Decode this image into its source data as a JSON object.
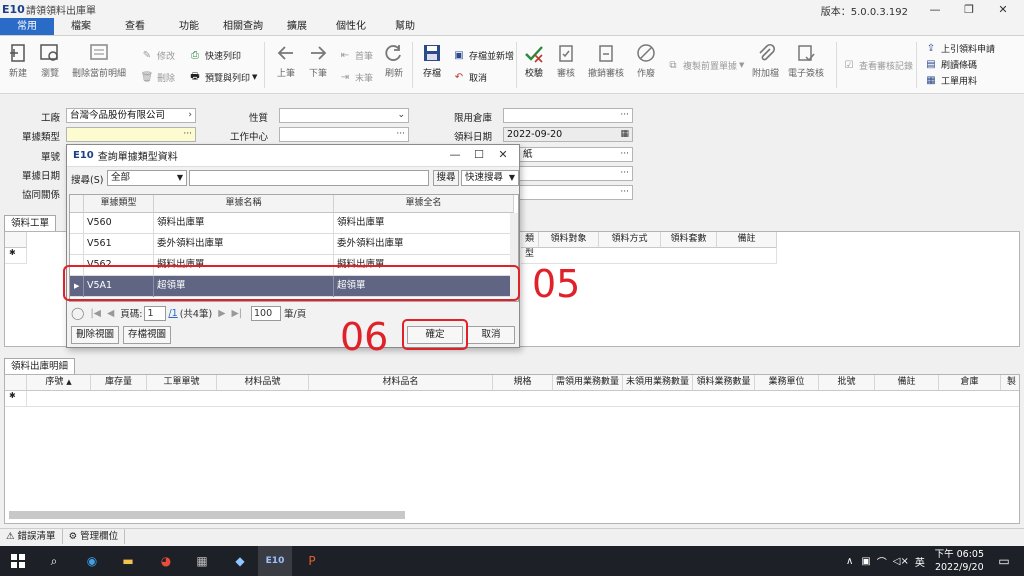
{
  "app": {
    "logo": "E10",
    "title": "請領領料出庫單",
    "version": "版本：5.0.0.3.192",
    "win_min": "—",
    "win_max": "❐",
    "win_close": "✕"
  },
  "menu": {
    "tabs": [
      "常用",
      "檔案",
      "查看",
      "功能",
      "相關查詢",
      "擴展",
      "個性化",
      "幫助"
    ]
  },
  "ribbon": {
    "new": "新建",
    "browse": "瀏覽",
    "delete_detail": "刪除當前明細",
    "modify": "修改",
    "delete": "刪除",
    "quick_print": "快速列印",
    "preview_print": "預覽與列印",
    "prev": "上筆",
    "next": "下筆",
    "first": "首筆",
    "last": "末筆",
    "refresh": "刷新",
    "save": "存檔",
    "save_new": "存檔並新增",
    "cancel": "取消",
    "validate": "校驗",
    "approve": "審核",
    "unapprove": "撤銷審核",
    "void": "作廢",
    "copy_prev": "複製前置單據",
    "attachment": "附加檔",
    "esign": "電子簽核",
    "view_audit": "查看審核記錄",
    "import_request": "上引領料申請",
    "refresh_barcode": "刷讀條碼",
    "work_materials": "工單用料"
  },
  "form": {
    "factory_label": "工廠",
    "factory_value": "台灣今品股份有限公司",
    "doctype_label": "單據類型",
    "docno_label": "單號",
    "docdate_label": "單據日期",
    "relation_label": "協同關係",
    "nature_label": "性質",
    "workcenter_label": "工作中心",
    "warehouse_label": "限用倉庫",
    "issue_date_label": "領料日期",
    "issue_date_value": "2022-09-20",
    "partial_r3": "紙",
    "ellipsis": "···"
  },
  "upper_grid": {
    "tab1": "領料工單",
    "headers_visible": [
      "類型",
      "領料對象",
      "領料方式",
      "領料套數",
      "備註"
    ]
  },
  "dialog": {
    "logo": "E10",
    "title": "查詢單據類型資料",
    "search_label": "搜尋(S)",
    "search_scope": "全部",
    "search_button": "搜尋",
    "search_mode": "快速搜尋",
    "columns": [
      "單據類型",
      "單據名稱",
      "單據全名"
    ],
    "rows": [
      {
        "code": "V560",
        "name": "領料出庫單",
        "full": "領料出庫單"
      },
      {
        "code": "V561",
        "name": "委外領料出庫單",
        "full": "委外領料出庫單"
      },
      {
        "code": "V562",
        "name": "擬料出庫單",
        "full": "擬料出庫單"
      },
      {
        "code": "V5A1",
        "name": "超領單",
        "full": "超領單"
      }
    ],
    "pager": {
      "page_label": "頁碼:",
      "page_value": "1",
      "total_pages": "/1",
      "total_records": "(共4筆)",
      "page_size": "100",
      "per_page": "筆/頁"
    },
    "delete_view": "刪除視圖",
    "save_view": "存檔視圖",
    "ok": "確定",
    "cancel": "取消"
  },
  "annotations": {
    "step5": "05",
    "step6": "06"
  },
  "lower_grid": {
    "tab": "領料出庫明細",
    "headers": [
      "序號",
      "庫存量",
      "工單單號",
      "材料品號",
      "材料品名",
      "規格",
      "需領用業務數量",
      "未領用業務數量",
      "領料業務數量",
      "業務單位",
      "批號",
      "備註",
      "倉庫",
      "製"
    ]
  },
  "statusbar": {
    "errors": "錯誤清單",
    "manage_fields": "管理欄位"
  },
  "taskbar": {
    "e10": "E10",
    "ime": "英",
    "time": "下午 06:05",
    "date": "2022/9/20"
  },
  "colors": {
    "accent": "#2a6bc7",
    "selected_row": "#5f6583",
    "annotation": "#e0212a",
    "required_field": "#fdfbd0"
  }
}
